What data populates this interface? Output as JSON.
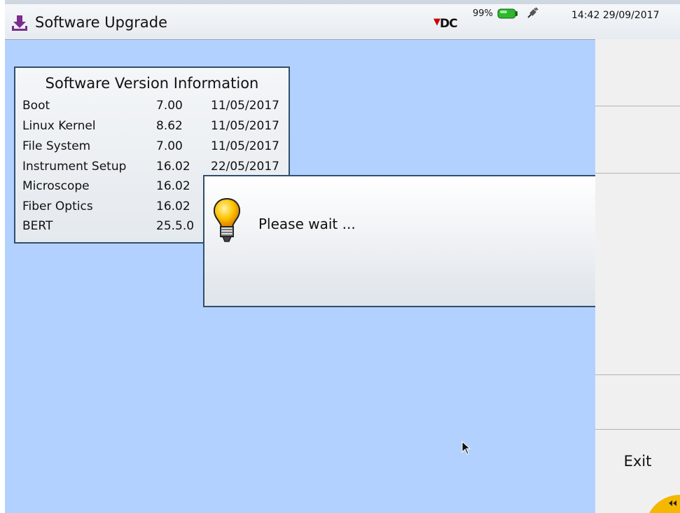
{
  "header": {
    "title": "Software Upgrade",
    "logo_text": "DC",
    "battery_percent": "99%",
    "time": "14:42",
    "date": "29/09/2017",
    "icons": [
      "download-icon",
      "battery-icon",
      "plug-icon"
    ]
  },
  "version_info": {
    "title": "Software Version Information",
    "rows": [
      {
        "name": "Boot",
        "version": "7.00",
        "date": "11/05/2017"
      },
      {
        "name": "Linux Kernel",
        "version": "8.62",
        "date": "11/05/2017"
      },
      {
        "name": "File System",
        "version": "7.00",
        "date": "11/05/2017"
      },
      {
        "name": "Instrument Setup",
        "version": "16.02",
        "date": "22/05/2017"
      },
      {
        "name": "Microscope",
        "version": "16.02",
        "date": ""
      },
      {
        "name": "Fiber Optics",
        "version": "16.02",
        "date": ""
      },
      {
        "name": "BERT",
        "version": "25.5.0",
        "date": ""
      }
    ]
  },
  "dialog": {
    "message": "Please wait ...",
    "icon": "lightbulb-icon"
  },
  "sidebar": {
    "buttons": [
      "",
      "",
      "",
      "",
      "",
      "Exit"
    ]
  },
  "colors": {
    "background": "#b3d1ff",
    "border": "#2f4f6b",
    "app_icon": "#7b2d8e",
    "battery": "#2db82d",
    "corner_tab": "#f5b700"
  }
}
